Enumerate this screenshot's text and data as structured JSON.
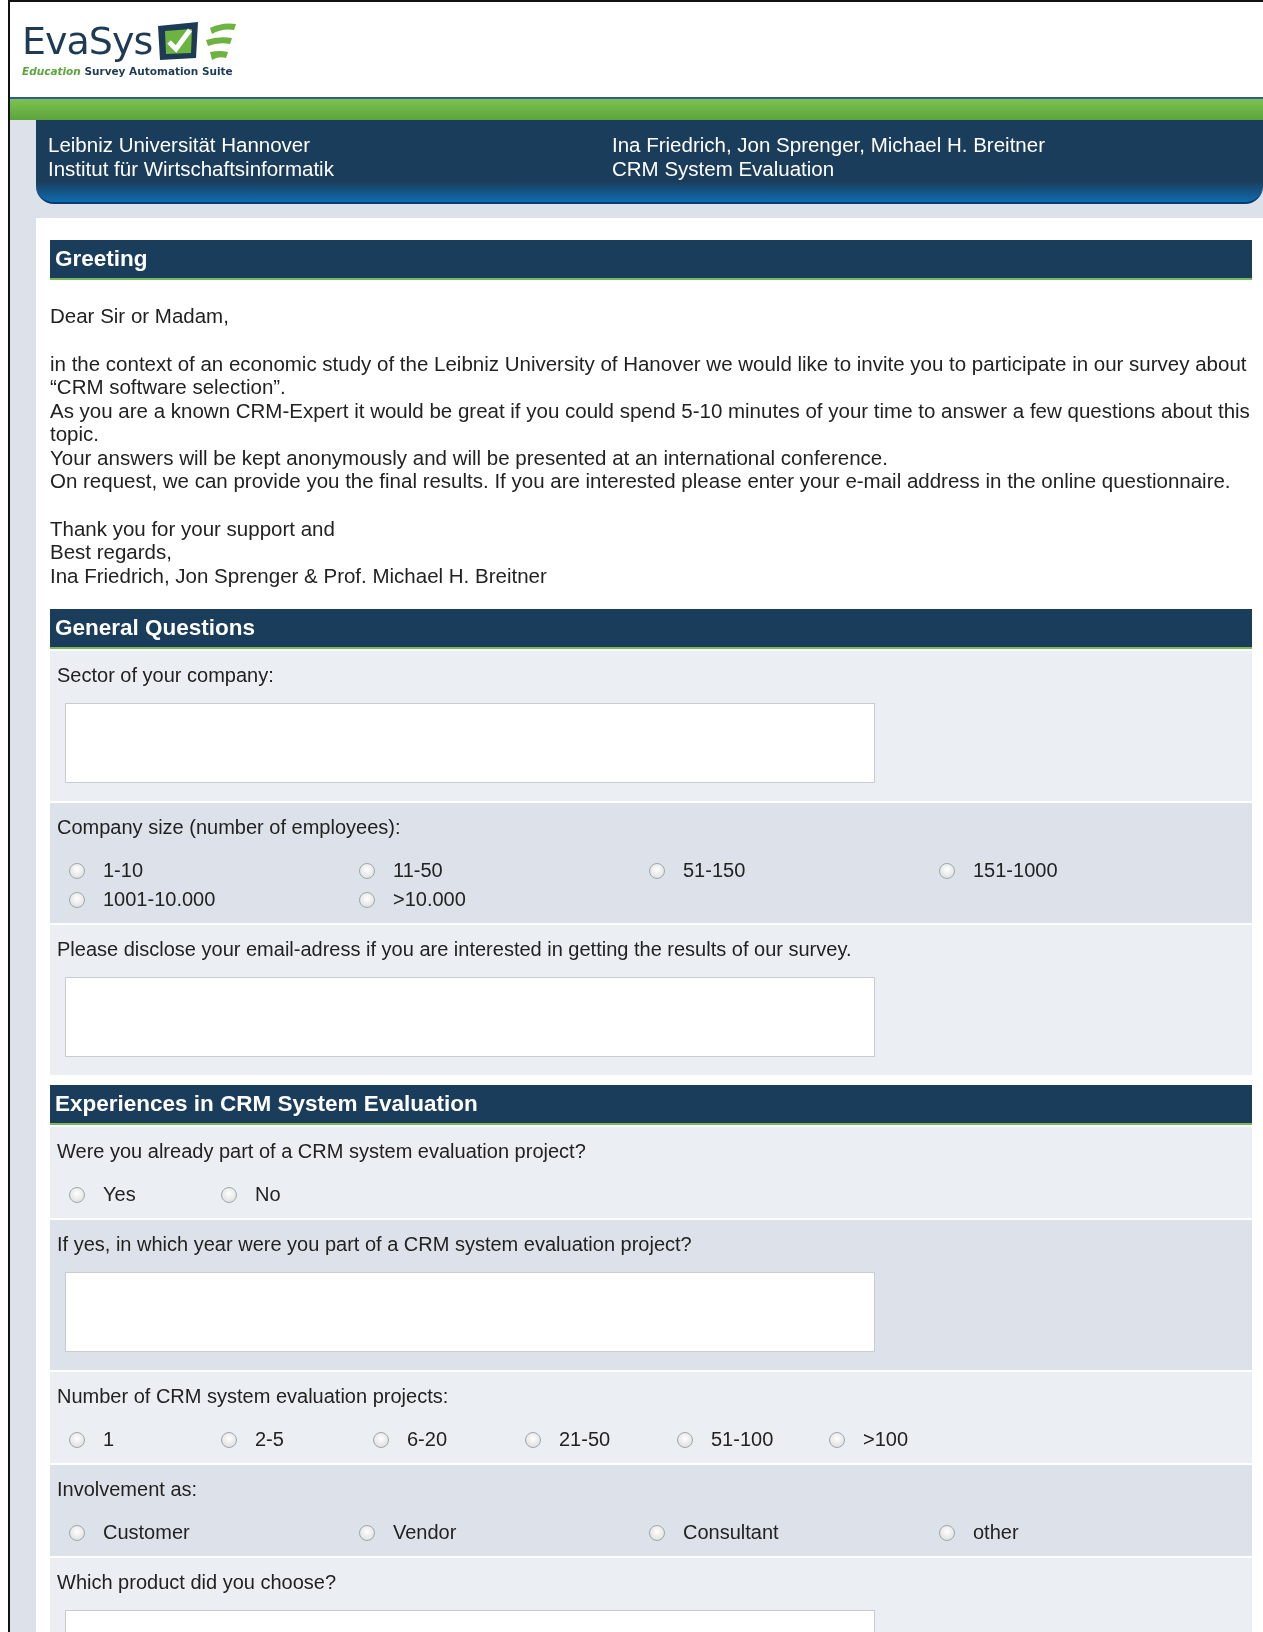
{
  "logo": {
    "name": "EvaSys",
    "tagline_prefix": "Education",
    "tagline": "Survey Automation Suite"
  },
  "header": {
    "left": [
      "Leibniz Universität Hannover",
      "Institut für Wirtschaftsinformatik"
    ],
    "right": [
      "Ina Friedrich, Jon Sprenger, Michael H. Breitner",
      "CRM System Evaluation"
    ]
  },
  "sections": [
    {
      "title": "Greeting",
      "kind": "text",
      "paragraphs": [
        [
          "Dear Sir or Madam,"
        ],
        [
          "in the context of an economic study of the Leibniz University of Hanover we would like to invite you to participate in our survey about “CRM software selection”.",
          "As you are a known CRM-Expert it would be great if you could spend 5-10 minutes of your time to answer a few questions about this topic.",
          "Your answers will be kept anonymously and will be presented at an international conference.",
          "On request, we can provide you the final results. If you are interested please enter your e-mail address in the online questionnaire."
        ],
        [
          "Thank you for your support and",
          "Best regards,",
          "Ina Friedrich, Jon Sprenger & Prof. Michael H. Breitner"
        ]
      ]
    },
    {
      "title": "General Questions",
      "kind": "questions",
      "questions": [
        {
          "kind": "text",
          "label": "Sector of your company:"
        },
        {
          "kind": "choicegrid",
          "label": "Company size (number of employees):",
          "options": [
            {
              "label": "1-10",
              "selected": false
            },
            {
              "label": "11-50",
              "selected": false
            },
            {
              "label": "51-150",
              "selected": false
            },
            {
              "label": "151-1000",
              "selected": false
            },
            {
              "label": "1001-10.000",
              "selected": false
            },
            {
              "label": ">10.000",
              "selected": false
            }
          ]
        },
        {
          "kind": "text",
          "label": "Please disclose your email-adress if you are interested in getting the results of our survey."
        }
      ]
    },
    {
      "title": "Experiences in CRM System Evaluation",
      "kind": "questions",
      "questions": [
        {
          "kind": "choicerow",
          "label": "Were you already part of a CRM system evaluation project?",
          "options": [
            {
              "label": "Yes",
              "selected": false
            },
            {
              "label": "No",
              "selected": false
            }
          ]
        },
        {
          "kind": "text",
          "label": "If yes, in which year were you part of a CRM system evaluation project?"
        },
        {
          "kind": "choicerow",
          "label": "Number of CRM system evaluation projects:",
          "options": [
            {
              "label": "1",
              "selected": false
            },
            {
              "label": "2-5",
              "selected": false
            },
            {
              "label": "6-20",
              "selected": false
            },
            {
              "label": "21-50",
              "selected": false
            },
            {
              "label": "51-100",
              "selected": false
            },
            {
              "label": ">100",
              "selected": false
            }
          ]
        },
        {
          "kind": "choicegrid",
          "label": "Involvement as:",
          "options": [
            {
              "label": "Customer",
              "selected": false
            },
            {
              "label": "Vendor",
              "selected": false
            },
            {
              "label": "Consultant",
              "selected": false
            },
            {
              "label": "other",
              "selected": false
            }
          ]
        },
        {
          "kind": "text",
          "label": "Which product did you choose?"
        }
      ]
    }
  ]
}
